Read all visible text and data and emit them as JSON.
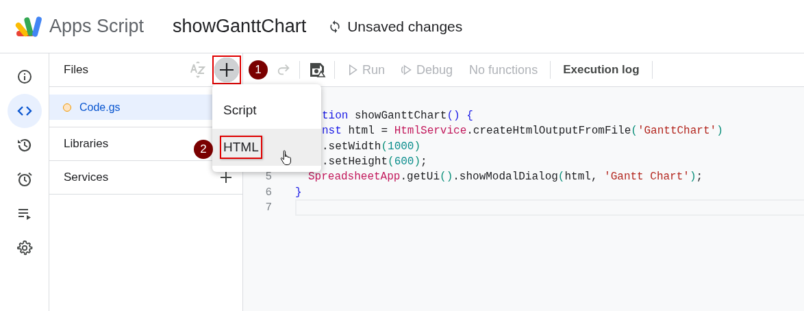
{
  "header": {
    "app_name": "Apps Script",
    "project_title": "showGanttChart",
    "save_status": "Unsaved changes"
  },
  "rail": {
    "items": [
      {
        "selected": false
      },
      {
        "selected": true
      },
      {
        "selected": false
      },
      {
        "selected": false
      },
      {
        "selected": false
      },
      {
        "selected": false
      }
    ]
  },
  "files_panel": {
    "title": "Files",
    "add_button": {
      "highlighted": true
    },
    "files": [
      {
        "name": "Code.gs",
        "selected": true,
        "unsaved": true
      }
    ],
    "sections": [
      "Libraries",
      "Services"
    ]
  },
  "toolbar": {
    "actions": [
      {
        "label": "Run",
        "disabled": true
      },
      {
        "label": "Debug",
        "disabled": true
      }
    ],
    "function_select": "No functions",
    "execution_log": "Execution log"
  },
  "callouts": [
    {
      "label": "1"
    },
    {
      "label": "2"
    }
  ],
  "menu": {
    "items": [
      {
        "label": "Script",
        "hovered": false,
        "highlighted": false
      },
      {
        "label": "HTML",
        "hovered": true,
        "highlighted": true
      }
    ]
  },
  "editor": {
    "lines": [
      {
        "kind": "clipped",
        "tokens": [
          {
            "kind": "kw",
            "s": "tion"
          },
          {
            "kind": "plain",
            "s": " showGanttChart"
          },
          {
            "kind": "brace",
            "s": "() {"
          }
        ]
      },
      {
        "kind": "clipped",
        "tokens": [
          {
            "kind": "kw",
            "s": "nst"
          },
          {
            "kind": "plain",
            "s": " html = "
          },
          {
            "kind": "cls",
            "s": "HtmlService"
          },
          {
            "kind": "plain",
            "s": ".createHtmlOutputFromFile"
          },
          {
            "kind": "paren",
            "s": "("
          },
          {
            "kind": "str",
            "s": "'GanttChart'"
          },
          {
            "kind": "paren",
            "s": ")"
          }
        ]
      },
      {
        "kind": "clipped",
        "tokens": [
          {
            "kind": "plain",
            "s": ".setWidth"
          },
          {
            "kind": "paren",
            "s": "("
          },
          {
            "kind": "num",
            "s": "1000"
          },
          {
            "kind": "paren",
            "s": ")"
          }
        ]
      },
      {
        "kind": "clipped",
        "tokens": [
          {
            "kind": "plain",
            "s": ".setHeight"
          },
          {
            "kind": "paren",
            "s": "("
          },
          {
            "kind": "num",
            "s": "600"
          },
          {
            "kind": "paren",
            "s": ")"
          },
          {
            "kind": "plain",
            "s": ";"
          }
        ]
      },
      {
        "kind": "indented",
        "number": "5",
        "tokens": [
          {
            "kind": "cls",
            "s": "SpreadsheetApp"
          },
          {
            "kind": "plain",
            "s": ".getUi"
          },
          {
            "kind": "paren",
            "s": "()"
          },
          {
            "kind": "plain",
            "s": ".showModalDialog"
          },
          {
            "kind": "paren",
            "s": "("
          },
          {
            "kind": "plain",
            "s": "html, "
          },
          {
            "kind": "str",
            "s": "'Gantt Chart'"
          },
          {
            "kind": "paren",
            "s": ")"
          },
          {
            "kind": "plain",
            "s": ";"
          }
        ]
      },
      {
        "kind": "full",
        "number": "6",
        "tokens": [
          {
            "kind": "brace",
            "s": "}"
          }
        ]
      },
      {
        "kind": "current",
        "number": "7"
      }
    ]
  }
}
